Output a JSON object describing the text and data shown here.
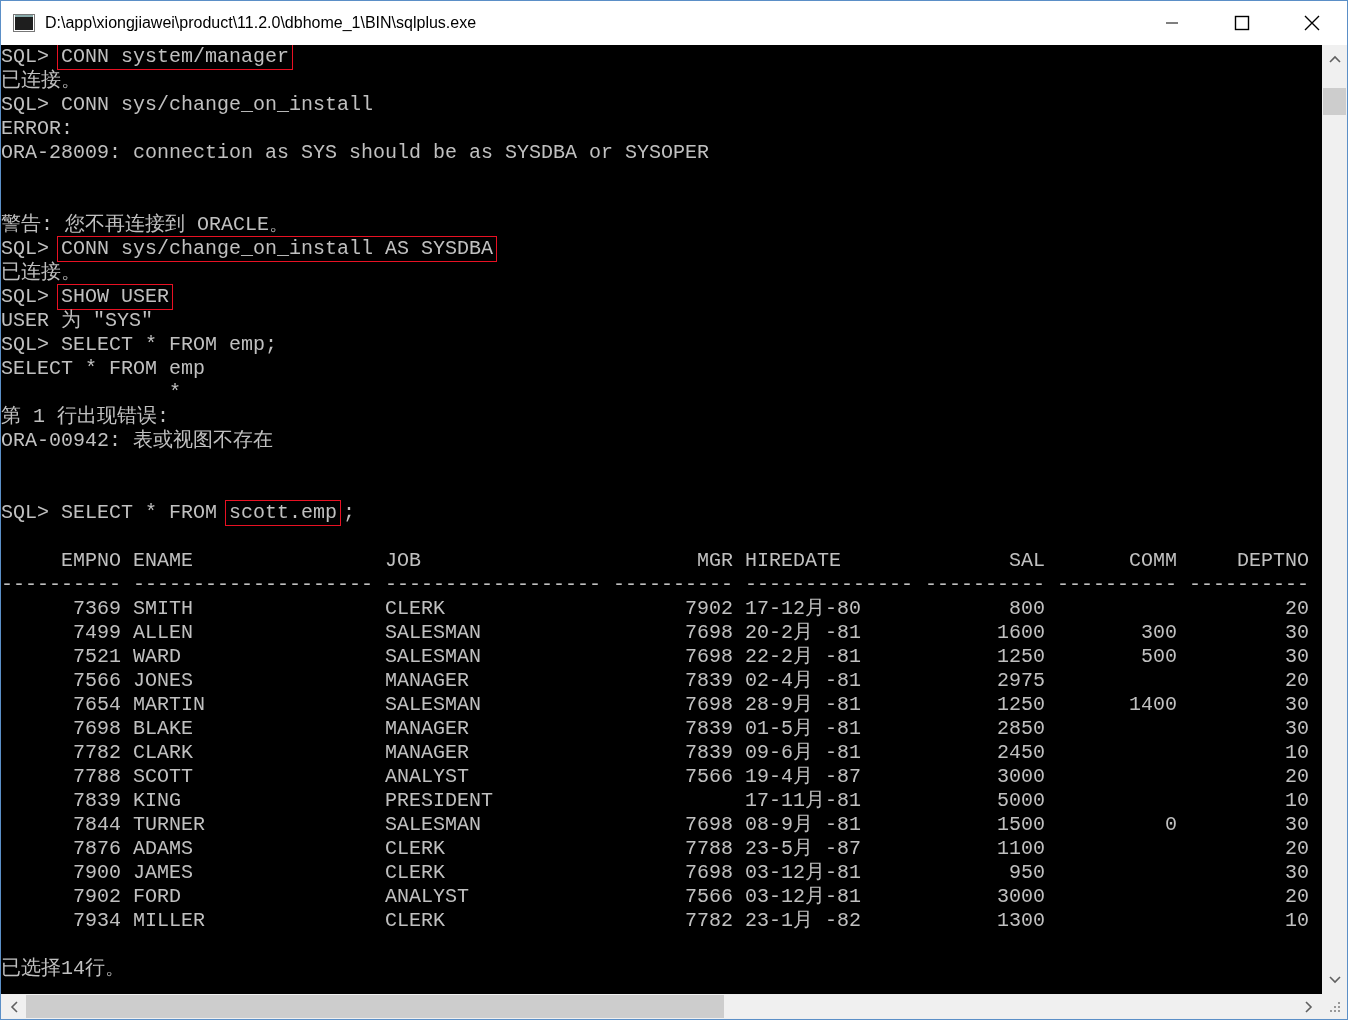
{
  "window": {
    "title": "D:\\app\\xiongjiawei\\product\\11.2.0\\dbhome_1\\BIN\\sqlplus.exe"
  },
  "console": {
    "lines_before": [
      {
        "kind": "text",
        "segments": [
          {
            "text": "SQL> ",
            "boxed": false
          },
          {
            "text": "CONN system/manager",
            "boxed": true
          }
        ]
      },
      {
        "kind": "text",
        "segments": [
          {
            "text": "已连接。",
            "boxed": false
          }
        ]
      },
      {
        "kind": "text",
        "segments": [
          {
            "text": "SQL> CONN sys/change_on_install",
            "boxed": false
          }
        ]
      },
      {
        "kind": "text",
        "segments": [
          {
            "text": "ERROR:",
            "boxed": false
          }
        ]
      },
      {
        "kind": "text",
        "segments": [
          {
            "text": "ORA-28009: connection as SYS should be as SYSDBA or SYSOPER",
            "boxed": false
          }
        ]
      },
      {
        "kind": "blank"
      },
      {
        "kind": "blank"
      },
      {
        "kind": "text",
        "segments": [
          {
            "text": "警告: 您不再连接到 ORACLE。",
            "boxed": false
          }
        ]
      },
      {
        "kind": "text",
        "segments": [
          {
            "text": "SQL> ",
            "boxed": false
          },
          {
            "text": "CONN sys/change_on_install AS SYSDBA",
            "boxed": true
          }
        ]
      },
      {
        "kind": "text",
        "segments": [
          {
            "text": "已连接。",
            "boxed": false
          }
        ]
      },
      {
        "kind": "text",
        "segments": [
          {
            "text": "SQL> ",
            "boxed": false
          },
          {
            "text": "SHOW USER",
            "boxed": true
          }
        ]
      },
      {
        "kind": "text",
        "segments": [
          {
            "text": "USER 为 \"SYS\"",
            "boxed": false
          }
        ]
      },
      {
        "kind": "text",
        "segments": [
          {
            "text": "SQL> SELECT * FROM emp;",
            "boxed": false
          }
        ]
      },
      {
        "kind": "text",
        "segments": [
          {
            "text": "SELECT * FROM emp",
            "boxed": false
          }
        ]
      },
      {
        "kind": "text",
        "segments": [
          {
            "text": "              *",
            "boxed": false
          }
        ]
      },
      {
        "kind": "text",
        "segments": [
          {
            "text": "第 1 行出现错误:",
            "boxed": false
          }
        ]
      },
      {
        "kind": "text",
        "segments": [
          {
            "text": "ORA-00942: 表或视图不存在",
            "boxed": false
          }
        ]
      },
      {
        "kind": "blank"
      },
      {
        "kind": "blank"
      },
      {
        "kind": "text",
        "segments": [
          {
            "text": "SQL> SELECT * FROM ",
            "boxed": false
          },
          {
            "text": "scott.emp",
            "boxed": true
          },
          {
            "text": ";",
            "boxed": false
          }
        ]
      },
      {
        "kind": "blank"
      }
    ],
    "result_table": {
      "columns": [
        {
          "label": "EMPNO",
          "underline": "----------"
        },
        {
          "label": "ENAME",
          "underline": "--------------------"
        },
        {
          "label": "JOB",
          "underline": "------------------"
        },
        {
          "label": "MGR",
          "underline": "----------"
        },
        {
          "label": "HIREDATE",
          "underline": "--------------"
        },
        {
          "label": "SAL",
          "underline": "----------"
        },
        {
          "label": "COMM",
          "underline": "----------"
        },
        {
          "label": "DEPTNO",
          "underline": "----------"
        }
      ],
      "rows": [
        [
          "7369",
          "SMITH",
          "CLERK",
          "7902",
          "17-12月-80",
          "800",
          null,
          "20"
        ],
        [
          "7499",
          "ALLEN",
          "SALESMAN",
          "7698",
          "20-2月 -81",
          "1600",
          "300",
          "30"
        ],
        [
          "7521",
          "WARD",
          "SALESMAN",
          "7698",
          "22-2月 -81",
          "1250",
          "500",
          "30"
        ],
        [
          "7566",
          "JONES",
          "MANAGER",
          "7839",
          "02-4月 -81",
          "2975",
          null,
          "20"
        ],
        [
          "7654",
          "MARTIN",
          "SALESMAN",
          "7698",
          "28-9月 -81",
          "1250",
          "1400",
          "30"
        ],
        [
          "7698",
          "BLAKE",
          "MANAGER",
          "7839",
          "01-5月 -81",
          "2850",
          null,
          "30"
        ],
        [
          "7782",
          "CLARK",
          "MANAGER",
          "7839",
          "09-6月 -81",
          "2450",
          null,
          "10"
        ],
        [
          "7788",
          "SCOTT",
          "ANALYST",
          "7566",
          "19-4月 -87",
          "3000",
          null,
          "20"
        ],
        [
          "7839",
          "KING",
          "PRESIDENT",
          null,
          "17-11月-81",
          "5000",
          null,
          "10"
        ],
        [
          "7844",
          "TURNER",
          "SALESMAN",
          "7698",
          "08-9月 -81",
          "1500",
          "0",
          "30"
        ],
        [
          "7876",
          "ADAMS",
          "CLERK",
          "7788",
          "23-5月 -87",
          "1100",
          null,
          "20"
        ],
        [
          "7900",
          "JAMES",
          "CLERK",
          "7698",
          "03-12月-81",
          "950",
          null,
          "30"
        ],
        [
          "7902",
          "FORD",
          "ANALYST",
          "7566",
          "03-12月-81",
          "3000",
          null,
          "20"
        ],
        [
          "7934",
          "MILLER",
          "CLERK",
          "7782",
          "23-1月 -82",
          "1300",
          null,
          "10"
        ]
      ]
    },
    "lines_after": [
      {
        "kind": "blank"
      },
      {
        "kind": "text",
        "segments": [
          {
            "text": "已选择14行。",
            "boxed": false
          }
        ]
      }
    ]
  }
}
